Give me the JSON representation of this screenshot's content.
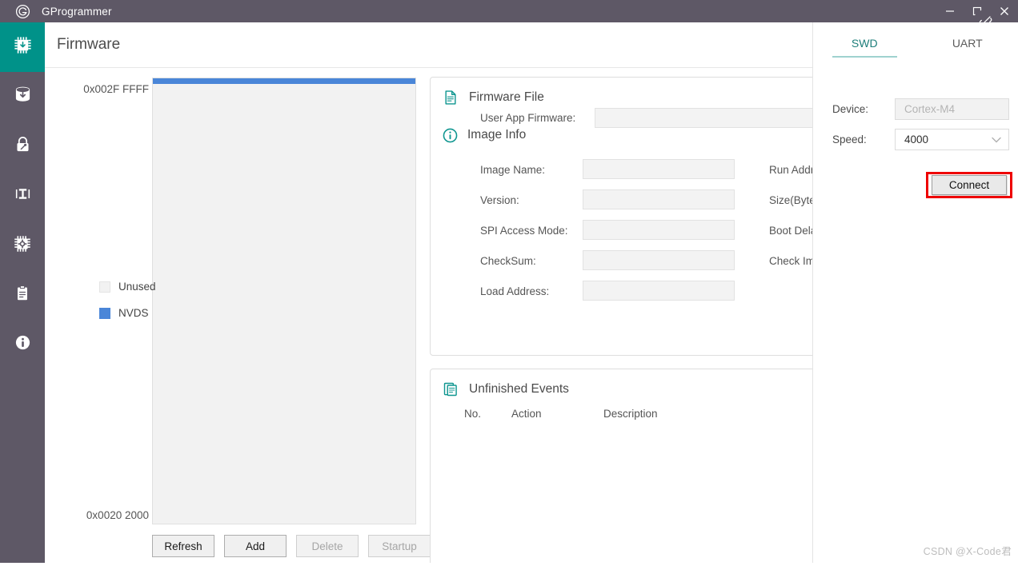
{
  "window": {
    "title": "GProgrammer",
    "logo_icon": "g-circle-logo-icon",
    "minimize_label": "─",
    "maximize_label": "□",
    "close_label": "✕"
  },
  "sidebar": {
    "items": [
      {
        "icon": "chip-download-icon",
        "name": "firmware",
        "active": true
      },
      {
        "icon": "database-download-icon",
        "name": "flash-download",
        "active": false
      },
      {
        "icon": "lock-key-icon",
        "name": "security",
        "active": false
      },
      {
        "icon": "efuse-tool-icon",
        "name": "efuse",
        "active": false
      },
      {
        "icon": "chip-settings-icon",
        "name": "chip-config",
        "active": false
      },
      {
        "icon": "clipboard-icon",
        "name": "log",
        "active": false
      },
      {
        "icon": "info-circle-icon",
        "name": "about",
        "active": false
      }
    ]
  },
  "header": {
    "title": "Firmware",
    "connection_icon": "broken-link-icon"
  },
  "memory_map": {
    "top_address": "0x002F FFFF",
    "bottom_address": "0x0020 2000",
    "nvds_color": "#4a86d8",
    "unused_color": "#f2f2f2",
    "legend": [
      {
        "label": "Unused",
        "color": "#f2f2f2"
      },
      {
        "label": "NVDS",
        "color": "#4a86d8"
      }
    ],
    "buttons": [
      {
        "label": "Refresh",
        "disabled": false
      },
      {
        "label": "Add",
        "disabled": false
      },
      {
        "label": "Delete",
        "disabled": true
      },
      {
        "label": "Startup",
        "disabled": true
      }
    ]
  },
  "firmware_file": {
    "icon": "document-icon",
    "title": "Firmware File",
    "user_app_firmware_label": "User App Firmware:",
    "user_app_firmware_value": "",
    "image_info": {
      "icon": "info-circle-icon",
      "title": "Image Info",
      "left_fields": [
        {
          "label": "Image Name:",
          "value": ""
        },
        {
          "label": "Version:",
          "value": ""
        },
        {
          "label": "SPI Access Mode:",
          "value": ""
        },
        {
          "label": "CheckSum:",
          "value": ""
        },
        {
          "label": "Load Address:",
          "value": ""
        }
      ],
      "right_fields": [
        {
          "label": "Run Address:",
          "value": ""
        },
        {
          "label": "Size(Byte):",
          "value": ""
        },
        {
          "label": "Boot Delay:",
          "value": ""
        },
        {
          "label": "Check Image:",
          "value": ""
        }
      ]
    }
  },
  "unfinished_events": {
    "icon": "documents-stack-icon",
    "title": "Unfinished Events",
    "columns": [
      "No.",
      "Action",
      "Description"
    ],
    "rows": []
  },
  "connection_panel": {
    "tabs": [
      {
        "label": "SWD",
        "active": true
      },
      {
        "label": "UART",
        "active": false
      }
    ],
    "device_label": "Device:",
    "device_value": "Cortex-M4",
    "speed_label": "Speed:",
    "speed_value": "4000",
    "chevron_icon": "chevron-down-icon",
    "connect_label": "Connect",
    "highlight_color": "#ee0000"
  },
  "watermark": "CSDN @X-Code君",
  "theme": {
    "titlebar": "#5e5866",
    "rail": "#5e5866",
    "accent": "#009289"
  }
}
